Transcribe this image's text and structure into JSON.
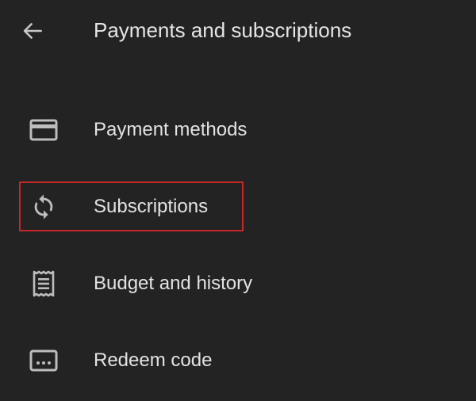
{
  "header": {
    "back_icon": "arrow-back-icon",
    "title": "Payments and subscriptions"
  },
  "menu": {
    "items": [
      {
        "label": "Payment methods",
        "icon": "credit-card-icon"
      },
      {
        "label": "Subscriptions",
        "icon": "sync-icon",
        "highlighted": true
      },
      {
        "label": "Budget and history",
        "icon": "receipt-icon"
      },
      {
        "label": "Redeem code",
        "icon": "redeem-code-icon"
      }
    ]
  },
  "colors": {
    "background": "#232323",
    "text": "#e3e3e3",
    "icon": "#bdbdbd",
    "highlight": "#c62828"
  }
}
